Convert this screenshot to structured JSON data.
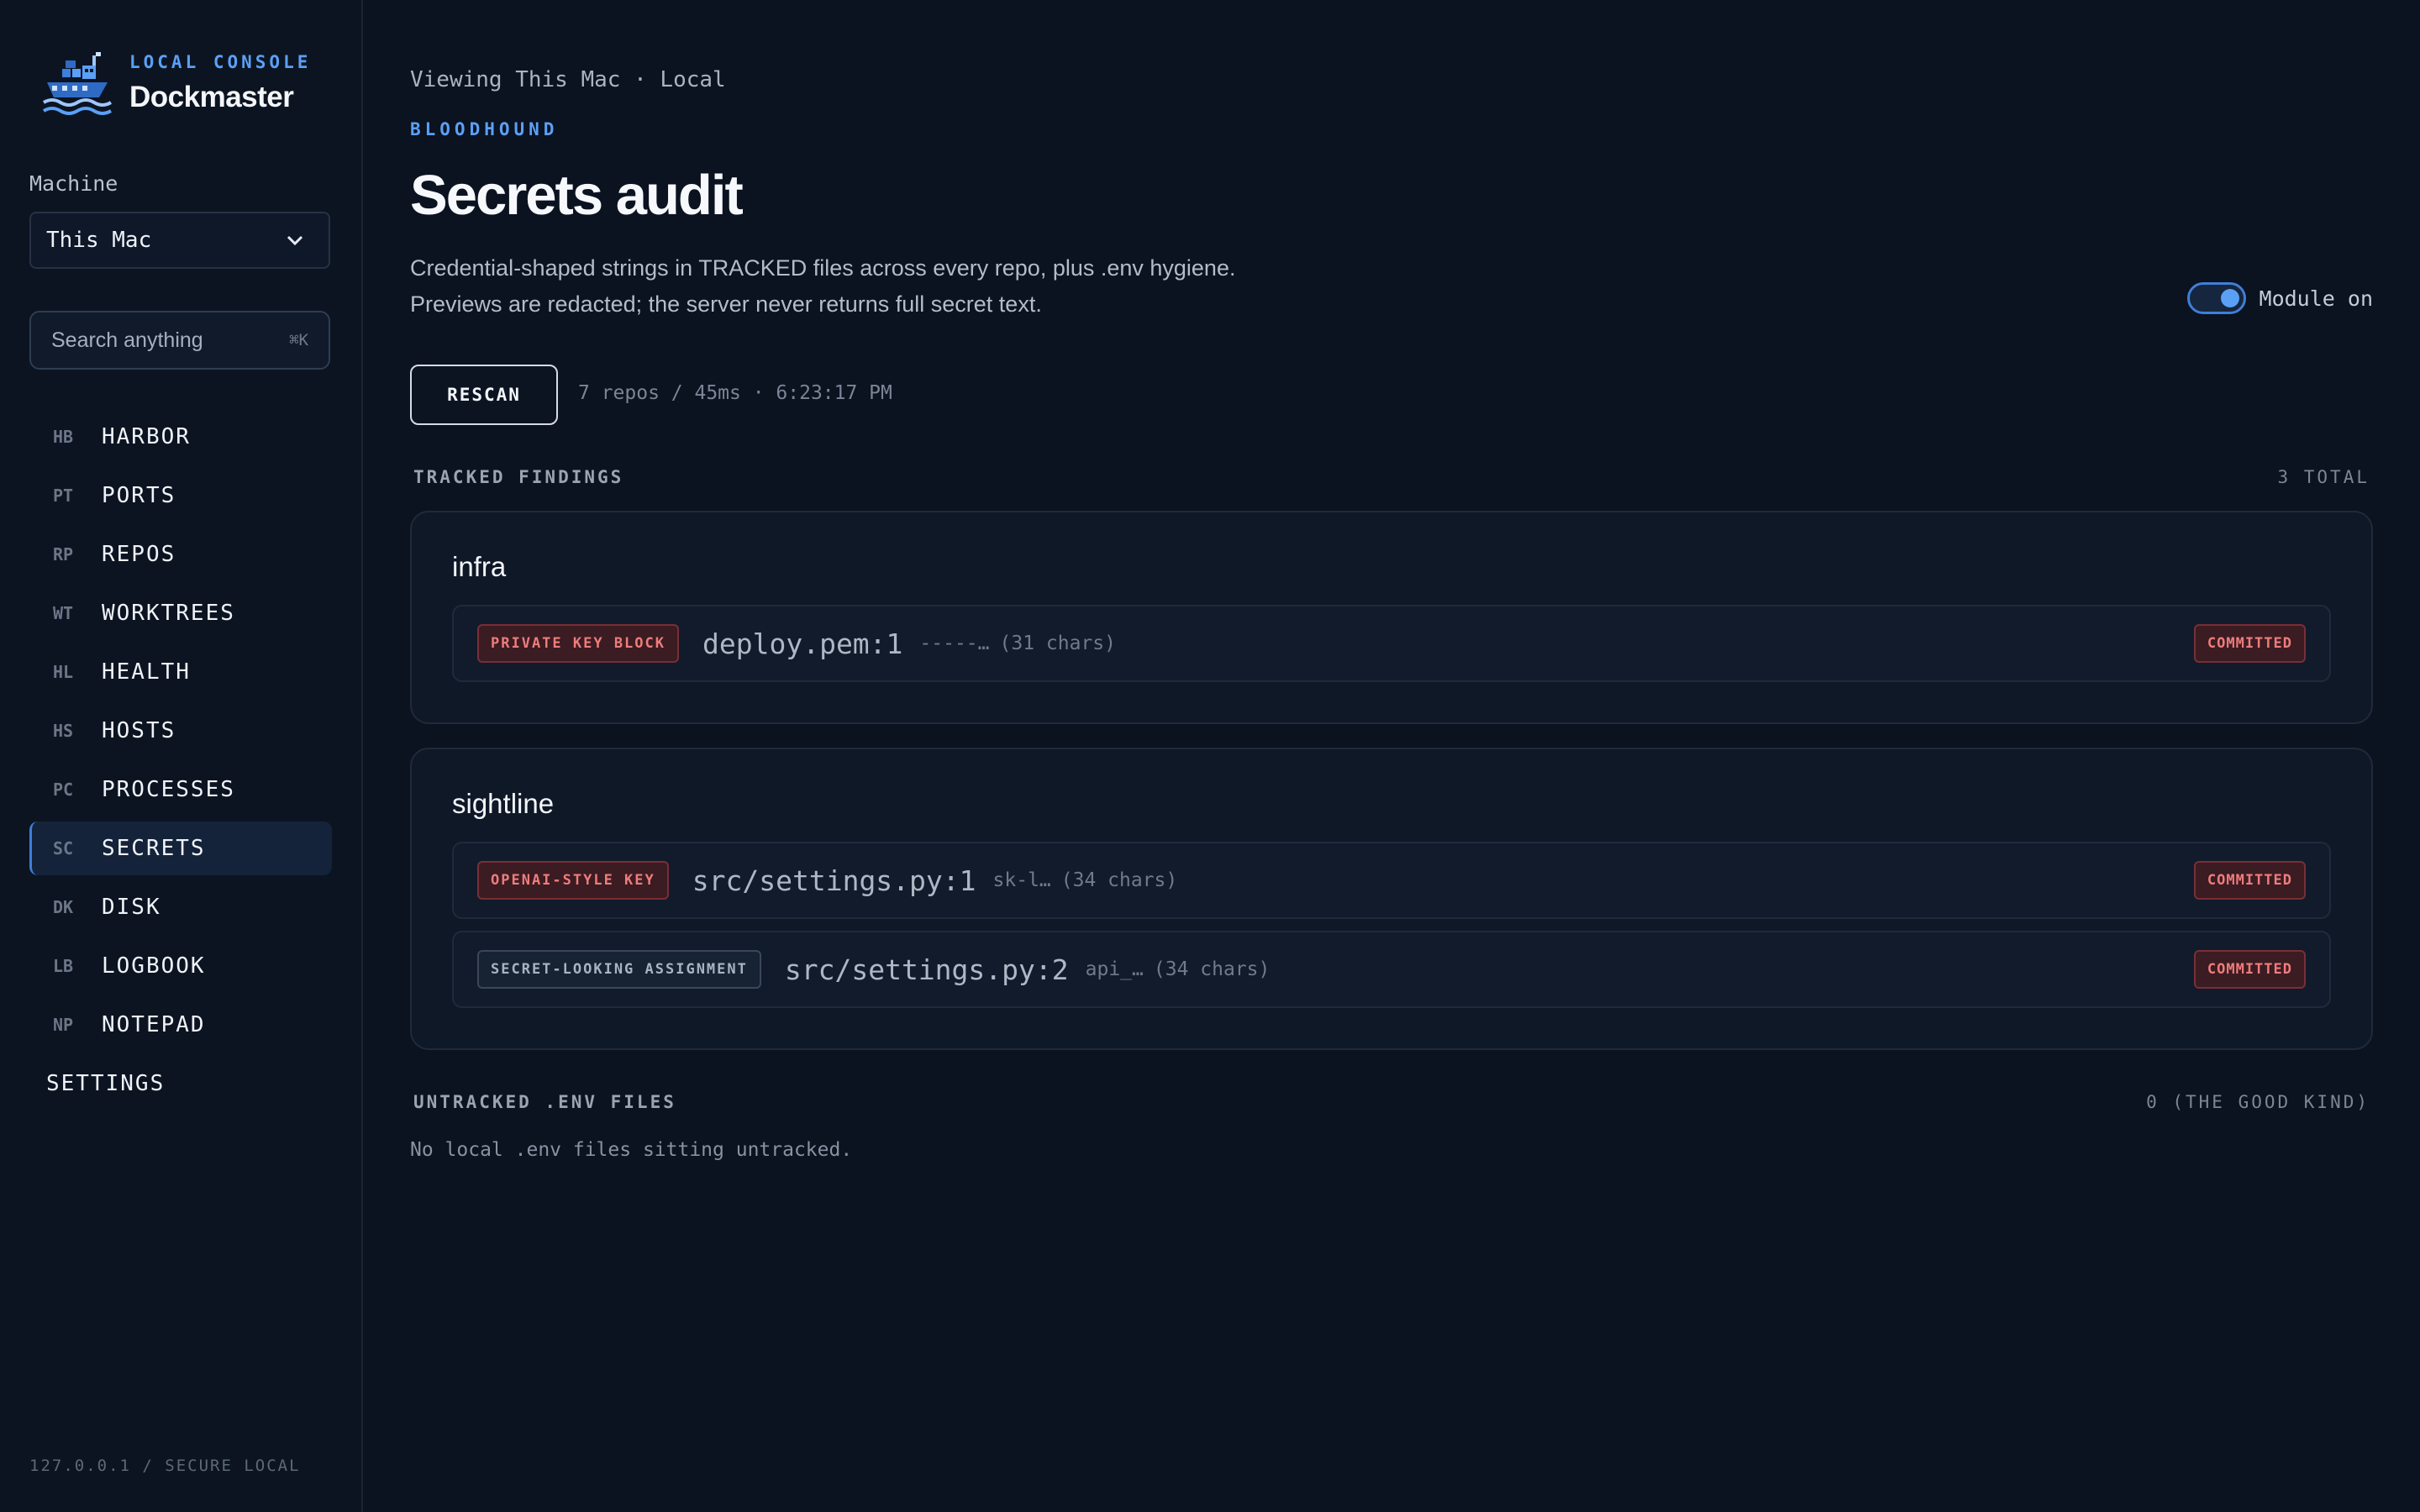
{
  "brand": {
    "eyebrow": "LOCAL CONSOLE",
    "name": "Dockmaster"
  },
  "machine": {
    "label": "Machine",
    "selected": "This Mac"
  },
  "search": {
    "placeholder": "Search anything",
    "shortcut": "⌘K"
  },
  "nav": [
    {
      "abbr": "HB",
      "label": "HARBOR"
    },
    {
      "abbr": "PT",
      "label": "PORTS"
    },
    {
      "abbr": "RP",
      "label": "REPOS"
    },
    {
      "abbr": "WT",
      "label": "WORKTREES"
    },
    {
      "abbr": "HL",
      "label": "HEALTH"
    },
    {
      "abbr": "HS",
      "label": "HOSTS"
    },
    {
      "abbr": "PC",
      "label": "PROCESSES"
    },
    {
      "abbr": "SC",
      "label": "SECRETS",
      "active": true
    },
    {
      "abbr": "DK",
      "label": "DISK"
    },
    {
      "abbr": "LB",
      "label": "LOGBOOK"
    },
    {
      "abbr": "NP",
      "label": "NOTEPAD"
    }
  ],
  "settings_label": "SETTINGS",
  "footer_host": "127.0.0.1 / SECURE LOCAL",
  "header": {
    "viewing": "Viewing This Mac · Local",
    "eyebrow": "BLOODHOUND",
    "title": "Secrets audit",
    "desc_line1": "Credential-shaped strings in TRACKED files across every repo, plus .env hygiene.",
    "desc_line2": "Previews are redacted; the server never returns full secret text.",
    "module_toggle": "Module on"
  },
  "scan": {
    "button": "RESCAN",
    "meta": "7 repos / 45ms · 6:23:17 PM"
  },
  "tracked": {
    "title": "TRACKED FINDINGS",
    "count": "3 TOTAL",
    "groups": [
      {
        "name": "infra",
        "findings": [
          {
            "tag": "PRIVATE KEY BLOCK",
            "severity": "red",
            "path": "deploy.pem:1",
            "preview": "-----…",
            "length": "(31 chars)",
            "status": "COMMITTED"
          }
        ]
      },
      {
        "name": "sightline",
        "findings": [
          {
            "tag": "OPENAI-STYLE KEY",
            "severity": "red",
            "path": "src/settings.py:1",
            "preview": "sk-l…",
            "length": "(34 chars)",
            "status": "COMMITTED"
          },
          {
            "tag": "SECRET-LOOKING ASSIGNMENT",
            "severity": "gray",
            "path": "src/settings.py:2",
            "preview": "api_…",
            "length": "(34 chars)",
            "status": "COMMITTED"
          }
        ]
      }
    ]
  },
  "untracked": {
    "title": "UNTRACKED .ENV FILES",
    "count": "0 (THE GOOD KIND)",
    "empty": "No local .env files sitting untracked."
  },
  "colors": {
    "accent": "#5aa0f5",
    "danger": "#ef7c7c",
    "bg": "#0b1220"
  }
}
